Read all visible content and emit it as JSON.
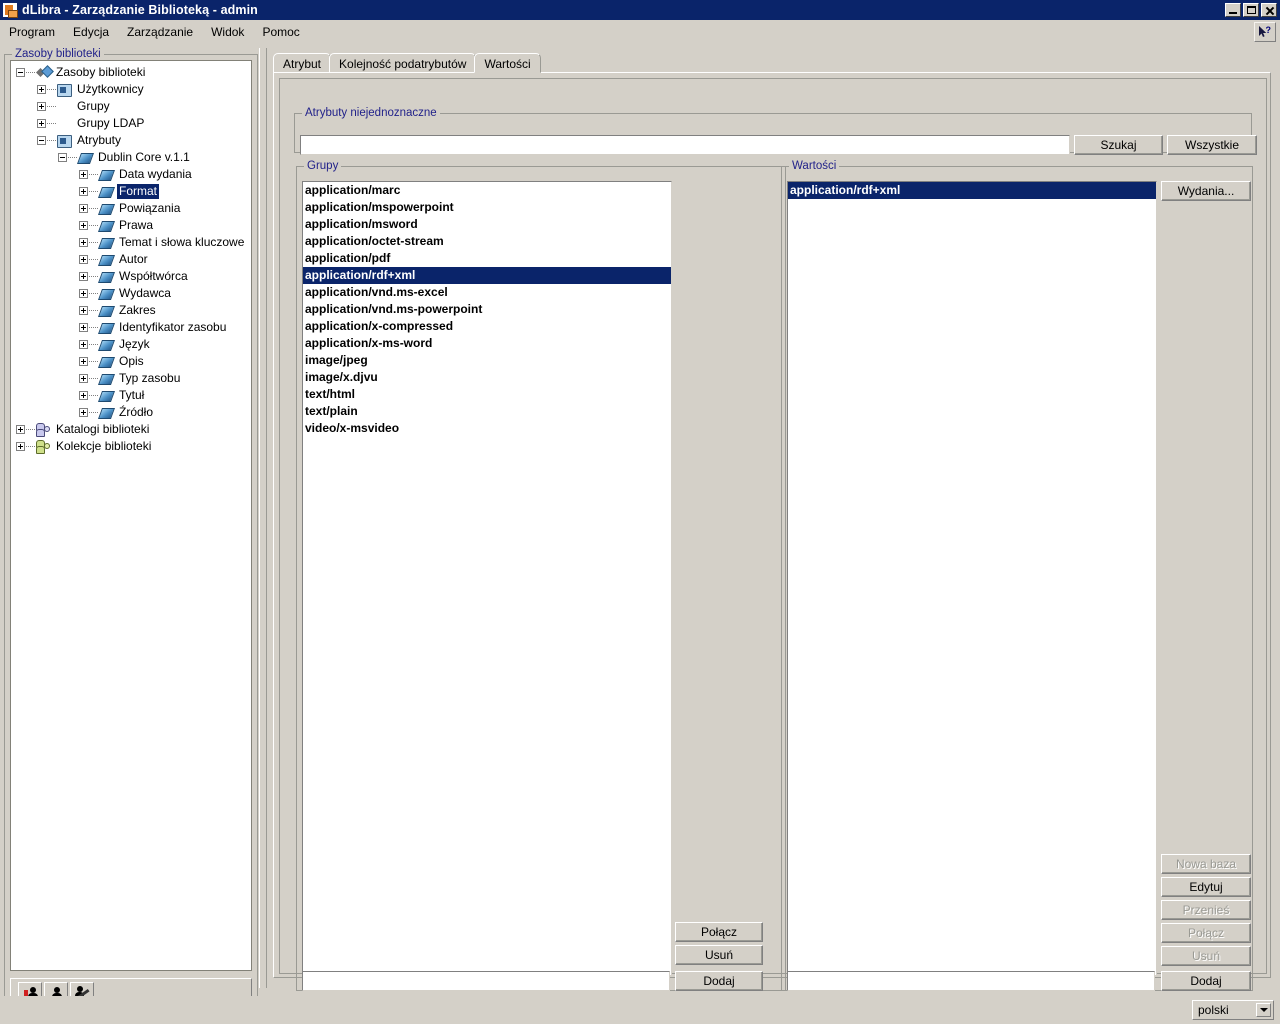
{
  "window": {
    "title": "dLibra - Zarządzanie Biblioteką - admin",
    "app_icon": "dlibra-icon",
    "minimize_label": "minimize-icon",
    "maximize_label": "maximize-icon",
    "close_label": "close-icon"
  },
  "menu": {
    "items": [
      {
        "label": "Program"
      },
      {
        "label": "Edycja"
      },
      {
        "label": "Zarządzanie"
      },
      {
        "label": "Widok"
      },
      {
        "label": "Pomoc"
      }
    ],
    "help_icon": "context-help-icon"
  },
  "sidebar": {
    "title": "Zasoby biblioteki",
    "tree": [
      {
        "label": "Zasoby biblioteki",
        "depth": 0,
        "toggle": "minus",
        "icon": "ic-root"
      },
      {
        "label": "Użytkownicy",
        "depth": 1,
        "toggle": "plus",
        "icon": "ic-folder"
      },
      {
        "label": "Grupy",
        "depth": 1,
        "toggle": "plus",
        "icon": "ic-folder2"
      },
      {
        "label": "Grupy LDAP",
        "depth": 1,
        "toggle": "plus",
        "icon": "ic-folder2"
      },
      {
        "label": "Atrybuty",
        "depth": 1,
        "toggle": "minus",
        "icon": "ic-folder"
      },
      {
        "label": "Dublin Core v.1.1",
        "depth": 2,
        "toggle": "minus",
        "icon": "ic-diamond"
      },
      {
        "label": "Data wydania",
        "depth": 3,
        "toggle": "plus",
        "icon": "ic-diamond"
      },
      {
        "label": "Format",
        "depth": 3,
        "toggle": "plus",
        "icon": "ic-diamond",
        "selected": true
      },
      {
        "label": "Powiązania",
        "depth": 3,
        "toggle": "plus",
        "icon": "ic-diamond"
      },
      {
        "label": "Prawa",
        "depth": 3,
        "toggle": "plus",
        "icon": "ic-diamond"
      },
      {
        "label": "Temat i słowa kluczowe",
        "depth": 3,
        "toggle": "plus",
        "icon": "ic-diamond"
      },
      {
        "label": "Autor",
        "depth": 3,
        "toggle": "plus",
        "icon": "ic-diamond"
      },
      {
        "label": "Współtwórca",
        "depth": 3,
        "toggle": "plus",
        "icon": "ic-diamond"
      },
      {
        "label": "Wydawca",
        "depth": 3,
        "toggle": "plus",
        "icon": "ic-diamond"
      },
      {
        "label": "Zakres",
        "depth": 3,
        "toggle": "plus",
        "icon": "ic-diamond"
      },
      {
        "label": "Identyfikator zasobu",
        "depth": 3,
        "toggle": "plus",
        "icon": "ic-diamond"
      },
      {
        "label": "Język",
        "depth": 3,
        "toggle": "plus",
        "icon": "ic-diamond"
      },
      {
        "label": "Opis",
        "depth": 3,
        "toggle": "plus",
        "icon": "ic-diamond"
      },
      {
        "label": "Typ zasobu",
        "depth": 3,
        "toggle": "plus",
        "icon": "ic-diamond"
      },
      {
        "label": "Tytuł",
        "depth": 3,
        "toggle": "plus",
        "icon": "ic-diamond"
      },
      {
        "label": "Źródło",
        "depth": 3,
        "toggle": "plus",
        "icon": "ic-diamond"
      },
      {
        "label": "Katalogi biblioteki",
        "depth": 0,
        "toggle": "plus",
        "icon": "ic-cat"
      },
      {
        "label": "Kolekcje biblioteki",
        "depth": 0,
        "toggle": "plus",
        "icon": "ic-col"
      }
    ],
    "toolbar": [
      {
        "icon": "user-key-icon"
      },
      {
        "icon": "user-icon"
      },
      {
        "icon": "user-tools-icon"
      }
    ]
  },
  "main": {
    "tabs": [
      {
        "label": "Atrybut",
        "selected": false
      },
      {
        "label": "Kolejność podatrybutów",
        "selected": false
      },
      {
        "label": "Wartości",
        "selected": true
      }
    ],
    "search_group": {
      "title": "Atrybuty niejednoznaczne",
      "input_value": "",
      "input_placeholder": "",
      "search_button": "Szukaj",
      "all_button": "Wszystkie"
    },
    "groups_panel": {
      "title": "Grupy",
      "items": [
        "application/marc",
        "application/mspowerpoint",
        "application/msword",
        "application/octet-stream",
        "application/pdf",
        "application/rdf+xml",
        "application/vnd.ms-excel",
        "application/vnd.ms-powerpoint",
        "application/x-compressed",
        "application/x-ms-word",
        "image/jpeg",
        "image/x.djvu",
        "text/html",
        "text/plain",
        "video/x-msvideo"
      ],
      "selected_index": 5,
      "input_value": "",
      "buttons": [
        {
          "label": "Połącz",
          "enabled": true
        },
        {
          "label": "Usuń",
          "enabled": true
        },
        {
          "label": "Dodaj",
          "enabled": true
        }
      ]
    },
    "values_panel": {
      "title": "Wartości",
      "items": [
        "application/rdf+xml"
      ],
      "selected_index": 0,
      "input_value": "",
      "editions_button": "Wydania...",
      "buttons": [
        {
          "label": "Nowa baza",
          "enabled": false
        },
        {
          "label": "Edytuj",
          "enabled": true
        },
        {
          "label": "Przenieś",
          "enabled": false
        },
        {
          "label": "Połącz",
          "enabled": false
        },
        {
          "label": "Usuń",
          "enabled": false
        },
        {
          "label": "Dodaj",
          "enabled": true
        }
      ]
    }
  },
  "statusbar": {
    "language": "polski"
  },
  "colors": {
    "selection": "#0a246a",
    "face": "#d4d0c8",
    "titlebar": "#0a246a",
    "group_label": "#22228a"
  }
}
